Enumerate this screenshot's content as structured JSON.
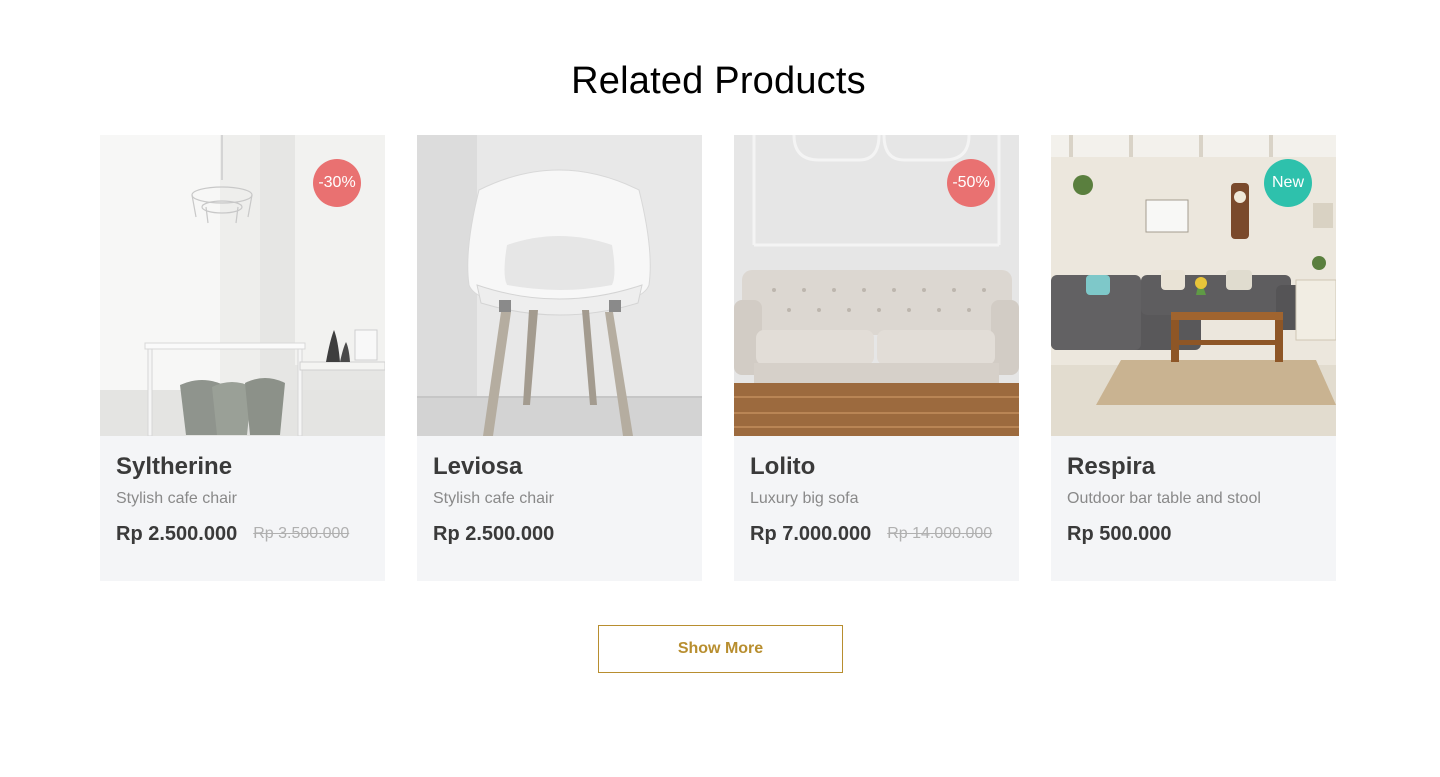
{
  "section": {
    "title": "Related Products",
    "show_more_label": "Show More"
  },
  "colors": {
    "accent": "#b88e2f",
    "discount_badge": "#e97171",
    "new_badge": "#2ec1ac",
    "card_background": "#f4f5f7"
  },
  "products": [
    {
      "name": "Syltherine",
      "description": "Stylish cafe chair",
      "price": "Rp 2.500.000",
      "old_price": "Rp 3.500.000",
      "badge": "-30%",
      "badge_type": "discount",
      "image": "white dining room with chandelier, table and grey stools"
    },
    {
      "name": "Leviosa",
      "description": "Stylish cafe chair",
      "price": "Rp 2.500.000",
      "old_price": "",
      "badge": "",
      "badge_type": "",
      "image": "white shell chair with wooden legs"
    },
    {
      "name": "Lolito",
      "description": "Luxury big sofa",
      "price": "Rp 7.000.000",
      "old_price": "Rp 14.000.000",
      "badge": "-50%",
      "badge_type": "discount",
      "image": "light grey tufted sofa on herringbone floor"
    },
    {
      "name": "Respira",
      "description": "Outdoor bar table and stool",
      "price": "Rp 500.000",
      "old_price": "",
      "badge": "New",
      "badge_type": "new",
      "image": "living room with dark sectional sofa and wooden coffee table"
    }
  ]
}
